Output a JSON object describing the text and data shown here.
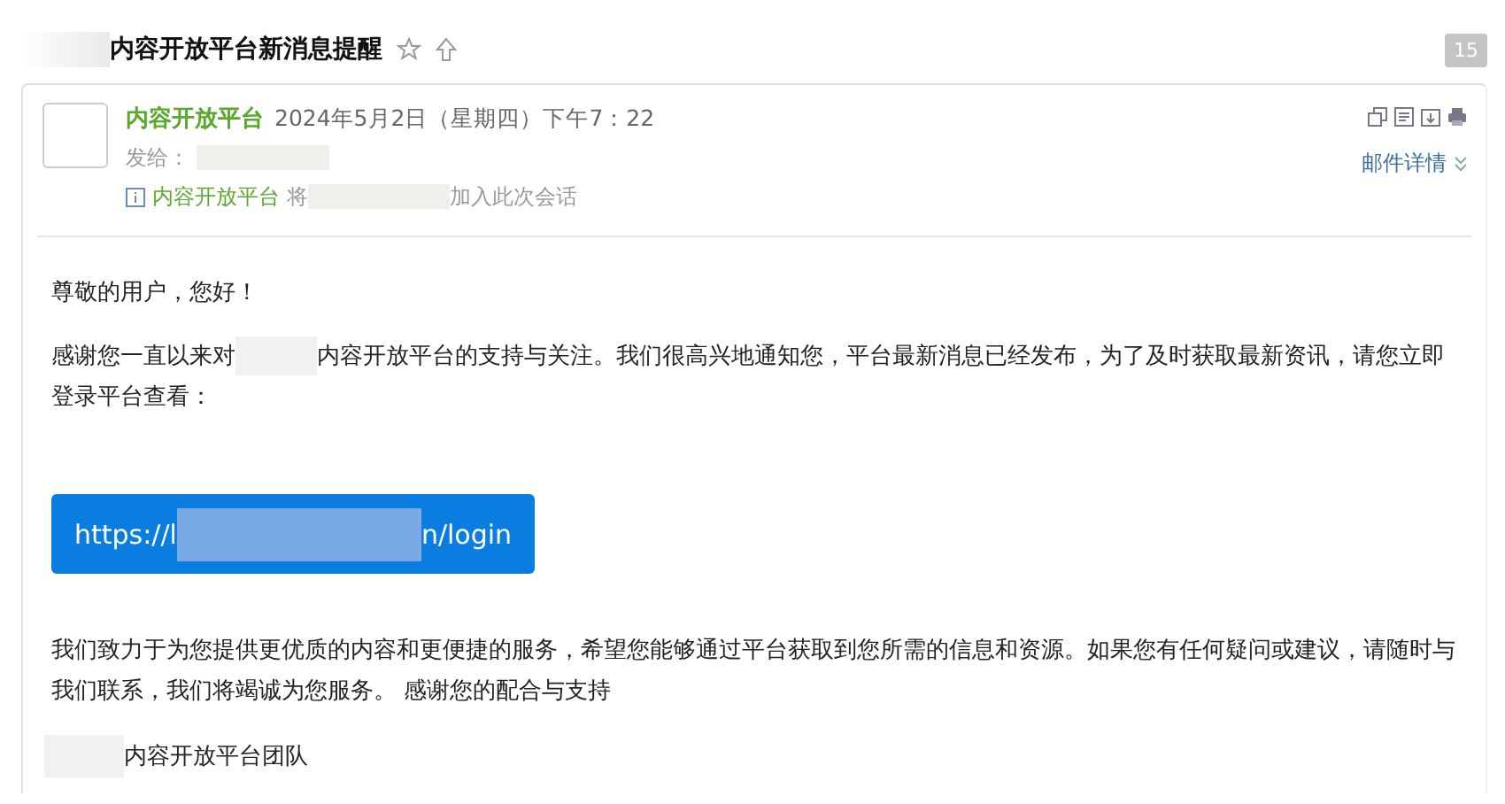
{
  "subject": {
    "title": "内容开放平台新消息提醒",
    "starred": false,
    "count": "15"
  },
  "header": {
    "sender": "内容开放平台",
    "time": "2024年5月2日（星期四）下午7：22",
    "to_label": "发给：",
    "notice_name": "内容开放平台",
    "notice_before": "将",
    "notice_after": "加入此次会话",
    "details": "邮件详情"
  },
  "body": {
    "greeting": "尊敬的用户，您好！",
    "para1_before": "感谢您一直以来对",
    "para1_after": "内容开放平台的支持与关注。我们很高兴地通知您，平台最新消息已经发布，为了及时获取最新资讯，请您立即登录平台查看：",
    "link_before": "https://l",
    "link_after": "n/login",
    "para2": "我们致力于为您提供更优质的内容和更便捷的服务，希望您能够通过平台获取到您所需的信息和资源。如果您有任何疑问或建议，请随时与我们联系，我们将竭诚为您服务。 感谢您的配合与支持",
    "signature": "内容开放平台团队"
  }
}
